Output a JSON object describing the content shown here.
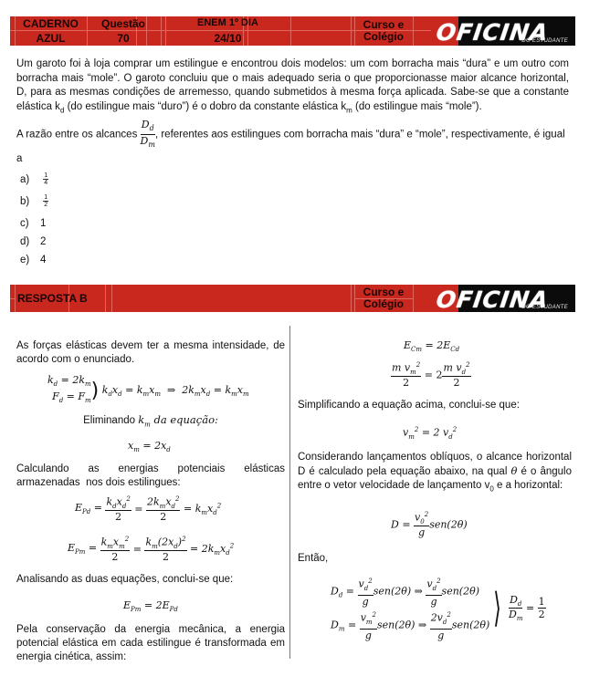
{
  "header": {
    "caderno_label": "CADERNO",
    "caderno_value": "AZUL",
    "questao_label": "Questão",
    "questao_value": "70",
    "exam_label": "ENEM 1º DIA",
    "exam_date": "24/10",
    "curso_line1": "Curso e",
    "curso_line2": "Colégio",
    "logo_main": "OFICINA",
    "logo_sub": "DO ESTUDANTE",
    "bar_color": "#c8281e"
  },
  "question": {
    "statement": "Um garoto foi à loja comprar um estilingue e encontrou dois modelos: um com borracha mais “dura” e um outro com borracha mais “mole”. O garoto concluiu que o mais adequado seria o que proporcionasse maior alcance horizontal, D, para as mesmas condições de arremesso, quando submetidos à mesma força aplicada. Sabe-se que a constante elástica k",
    "statement_sub_d": "d",
    "statement_mid": " (do estilingue mais “duro”) é o dobro da constante elástica k",
    "statement_sub_m": "m",
    "statement_end": " (do estilingue mais “mole”).",
    "prompt_start": "A razão entre os alcances ",
    "ratio_num": "Dd",
    "ratio_den": "Dm",
    "prompt_end": ", referentes  aos estilingues com borracha mais “dura” e “mole”, respectivamente,  é igual a",
    "options": [
      {
        "label": "a)",
        "num": "1",
        "den": "4",
        "value": ""
      },
      {
        "label": "b)",
        "num": "1",
        "den": "2",
        "value": ""
      },
      {
        "label": "c)",
        "value": "1"
      },
      {
        "label": "d)",
        "value": "2"
      },
      {
        "label": "e)",
        "value": "4"
      }
    ]
  },
  "answer_header": {
    "label": "RESPOSTA",
    "value": "B",
    "curso_line1": "Curso e",
    "curso_line2": "Colégio",
    "logo_main": "OFICINA",
    "logo_sub": "DO ESTUDANTE"
  },
  "solution": {
    "left": {
      "p1": "As forças elásticas devem ter a mesma intensidade, de acordo com o enunciado.",
      "eq1_a": "k_d = 2k_m",
      "eq1_b": "F_d = F_m",
      "eq1_c": "k_d x_d = k_m x_m  ⇒  2k_m x_d = k_m x_m",
      "elim_text": "Eliminando ",
      "elim_math": "k_m da equação:",
      "eq2": "x_m = 2x_d",
      "p2": "Calculando as energias potenciais elásticas armazenadas nos dois estilingues:",
      "eq3": "E_Pd = k_d x_d²/2 = 2k_m x_d²/2 = k_m x_d²",
      "eq4": "E_Pm = k_m x_m²/2 = k_m (2x_d)²/2 = 2k_m x_d²",
      "p3": "Analisando as duas equações, conclui-se que:",
      "eq5": "E_Pm = 2E_Pd",
      "p4": "Pela conservação da energia mecânica, a energia potencial elástica em cada estilingue é transformada em energia cinética, assim:"
    },
    "right": {
      "eq6": "E_Cm = 2E_Cd",
      "eq7": "m v_m²/2 = 2 m v_d²/2",
      "p5": "Simplificando a equação acima, conclui-se que:",
      "eq8": "v_m² = 2 v_d²",
      "p6_a": "Considerando lançamentos oblíquos, o alcance horizontal D é calculado pela equação abaixo, na qual ",
      "p6_theta": "θ",
      "p6_b": " é o ângulo entre o vetor velocidade de lançamento v",
      "p6_sub": "0",
      "p6_c": " e a horizontal:",
      "eq9": "D = v_0²/g sen(2θ)",
      "p7": "Então,",
      "eq10": "D_d = v_d²/g sen(2θ) ⇒ v_d²/g sen(2θ)",
      "eq11": "D_m = v_m²/g sen(2θ) ⇒ 2v_d²/g sen(2θ)",
      "eq12": "D_d/D_m = 1/2"
    }
  }
}
